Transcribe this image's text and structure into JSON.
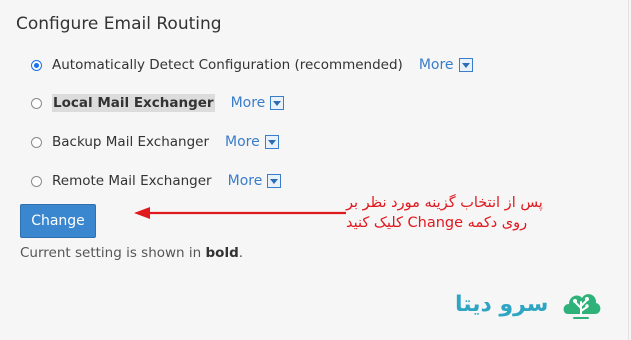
{
  "page": {
    "title": "Configure Email Routing"
  },
  "options": [
    {
      "label": "Automatically Detect Configuration (recommended)",
      "more": "More",
      "checked": true,
      "bold": false
    },
    {
      "label": "Local Mail Exchanger",
      "more": "More",
      "checked": false,
      "bold": true
    },
    {
      "label": "Backup Mail Exchanger",
      "more": "More",
      "checked": false,
      "bold": false
    },
    {
      "label": "Remote Mail Exchanger",
      "more": "More",
      "checked": false,
      "bold": false
    }
  ],
  "change_button": {
    "label": "Change"
  },
  "note": {
    "prefix": "Current setting is shown in ",
    "bold_word": "bold",
    "suffix": "."
  },
  "annotation": {
    "line1": "پس از انتخاب گزینه مورد نظر بر",
    "line2": "روی دکمه Change کلیک کنید",
    "color": "#e0191f"
  },
  "brand": {
    "name": "سرو دیتا",
    "color": "#2fa5c4",
    "logo_icon": "tree-cloud-icon"
  },
  "colors": {
    "link": "#3a7dc9",
    "button": "#3a86cf",
    "radio_checked": "#1a73e8"
  }
}
